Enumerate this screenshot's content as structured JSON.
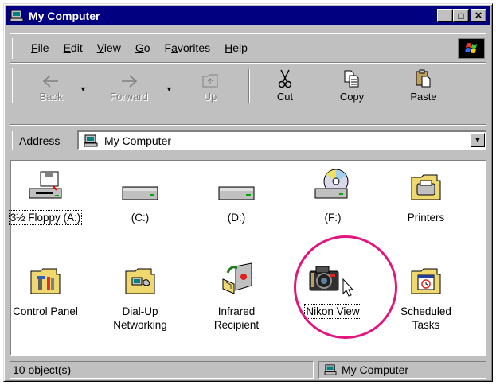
{
  "window": {
    "title": "My Computer"
  },
  "title_buttons": {
    "minimize": "_",
    "maximize": "□",
    "close": "×"
  },
  "menu": [
    {
      "label": "File",
      "accel": "F",
      "rest": "ile"
    },
    {
      "label": "Edit",
      "accel": "E",
      "rest": "dit"
    },
    {
      "label": "View",
      "accel": "V",
      "rest": "iew"
    },
    {
      "label": "Go",
      "accel": "G",
      "rest": "o"
    },
    {
      "label": "Favorites",
      "accel": "a",
      "pre": "F",
      "rest": "vorites"
    },
    {
      "label": "Help",
      "accel": "H",
      "rest": "elp"
    }
  ],
  "toolbar": {
    "back": "Back",
    "forward": "Forward",
    "up": "Up",
    "cut": "Cut",
    "copy": "Copy",
    "paste": "Paste"
  },
  "address": {
    "label": "Address",
    "value": "My Computer"
  },
  "items": [
    {
      "name": "3½ Floppy (A:)",
      "icon": "floppy-drive-icon"
    },
    {
      "name": "(C:)",
      "icon": "hard-drive-icon"
    },
    {
      "name": "(D:)",
      "icon": "hard-drive-icon"
    },
    {
      "name": "(F:)",
      "icon": "cd-drive-icon"
    },
    {
      "name": "Printers",
      "icon": "printers-folder-icon"
    },
    {
      "name": "Control Panel",
      "icon": "control-panel-folder-icon"
    },
    {
      "name": "Dial-Up\nNetworking",
      "icon": "dialup-folder-icon"
    },
    {
      "name": "Infrared\nRecipient",
      "icon": "infrared-icon"
    },
    {
      "name": "Nikon View",
      "icon": "camera-icon"
    },
    {
      "name": "Scheduled\nTasks",
      "icon": "scheduled-tasks-folder-icon"
    }
  ],
  "status": {
    "objects": "10 object(s)",
    "location": "My Computer"
  },
  "colors": {
    "titlebar": "#000080",
    "face": "#c0c0c0",
    "highlight_circle": "#e3147e"
  }
}
